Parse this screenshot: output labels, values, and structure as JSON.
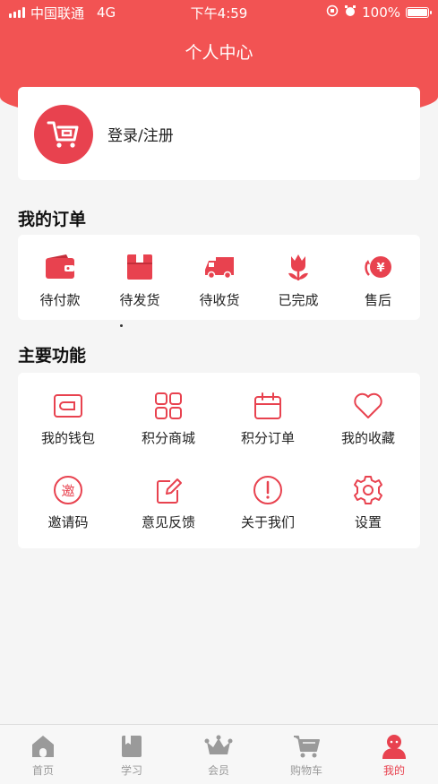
{
  "status_bar": {
    "carrier": "中国联通",
    "network": "4G",
    "time": "下午4:59",
    "battery": "100%",
    "battery_level": 1.0
  },
  "header": {
    "title": "个人中心"
  },
  "colors": {
    "accent": "#e8424f",
    "header": "#f25353",
    "tab_inactive": "#9a9a9a"
  },
  "user": {
    "login_label": "登录/注册",
    "avatar_icon": "shopping-cart-icon"
  },
  "orders": {
    "title": "我的订单",
    "items": [
      {
        "label": "待付款",
        "icon": "wallet-icon"
      },
      {
        "label": "待发货",
        "icon": "box-icon"
      },
      {
        "label": "待收货",
        "icon": "truck-icon"
      },
      {
        "label": "已完成",
        "icon": "flower-icon"
      },
      {
        "label": "售后",
        "icon": "yen-icon"
      }
    ]
  },
  "functions": {
    "title": "主要功能",
    "items": [
      {
        "label": "我的钱包",
        "icon": "wallet-outline-icon"
      },
      {
        "label": "积分商城",
        "icon": "grid-icon"
      },
      {
        "label": "积分订单",
        "icon": "calendar-icon"
      },
      {
        "label": "我的收藏",
        "icon": "heart-icon"
      },
      {
        "label": "邀请码",
        "icon": "invite-icon",
        "glyph": "邀"
      },
      {
        "label": "意见反馈",
        "icon": "edit-icon"
      },
      {
        "label": "关于我们",
        "icon": "info-icon"
      },
      {
        "label": "设置",
        "icon": "gear-icon"
      }
    ]
  },
  "tabbar": {
    "items": [
      {
        "label": "首页",
        "icon": "home-icon",
        "active": false
      },
      {
        "label": "学习",
        "icon": "book-icon",
        "active": false
      },
      {
        "label": "会员",
        "icon": "crown-icon",
        "active": false
      },
      {
        "label": "购物车",
        "icon": "cart-icon",
        "active": false
      },
      {
        "label": "我的",
        "icon": "user-icon",
        "active": true
      }
    ]
  }
}
